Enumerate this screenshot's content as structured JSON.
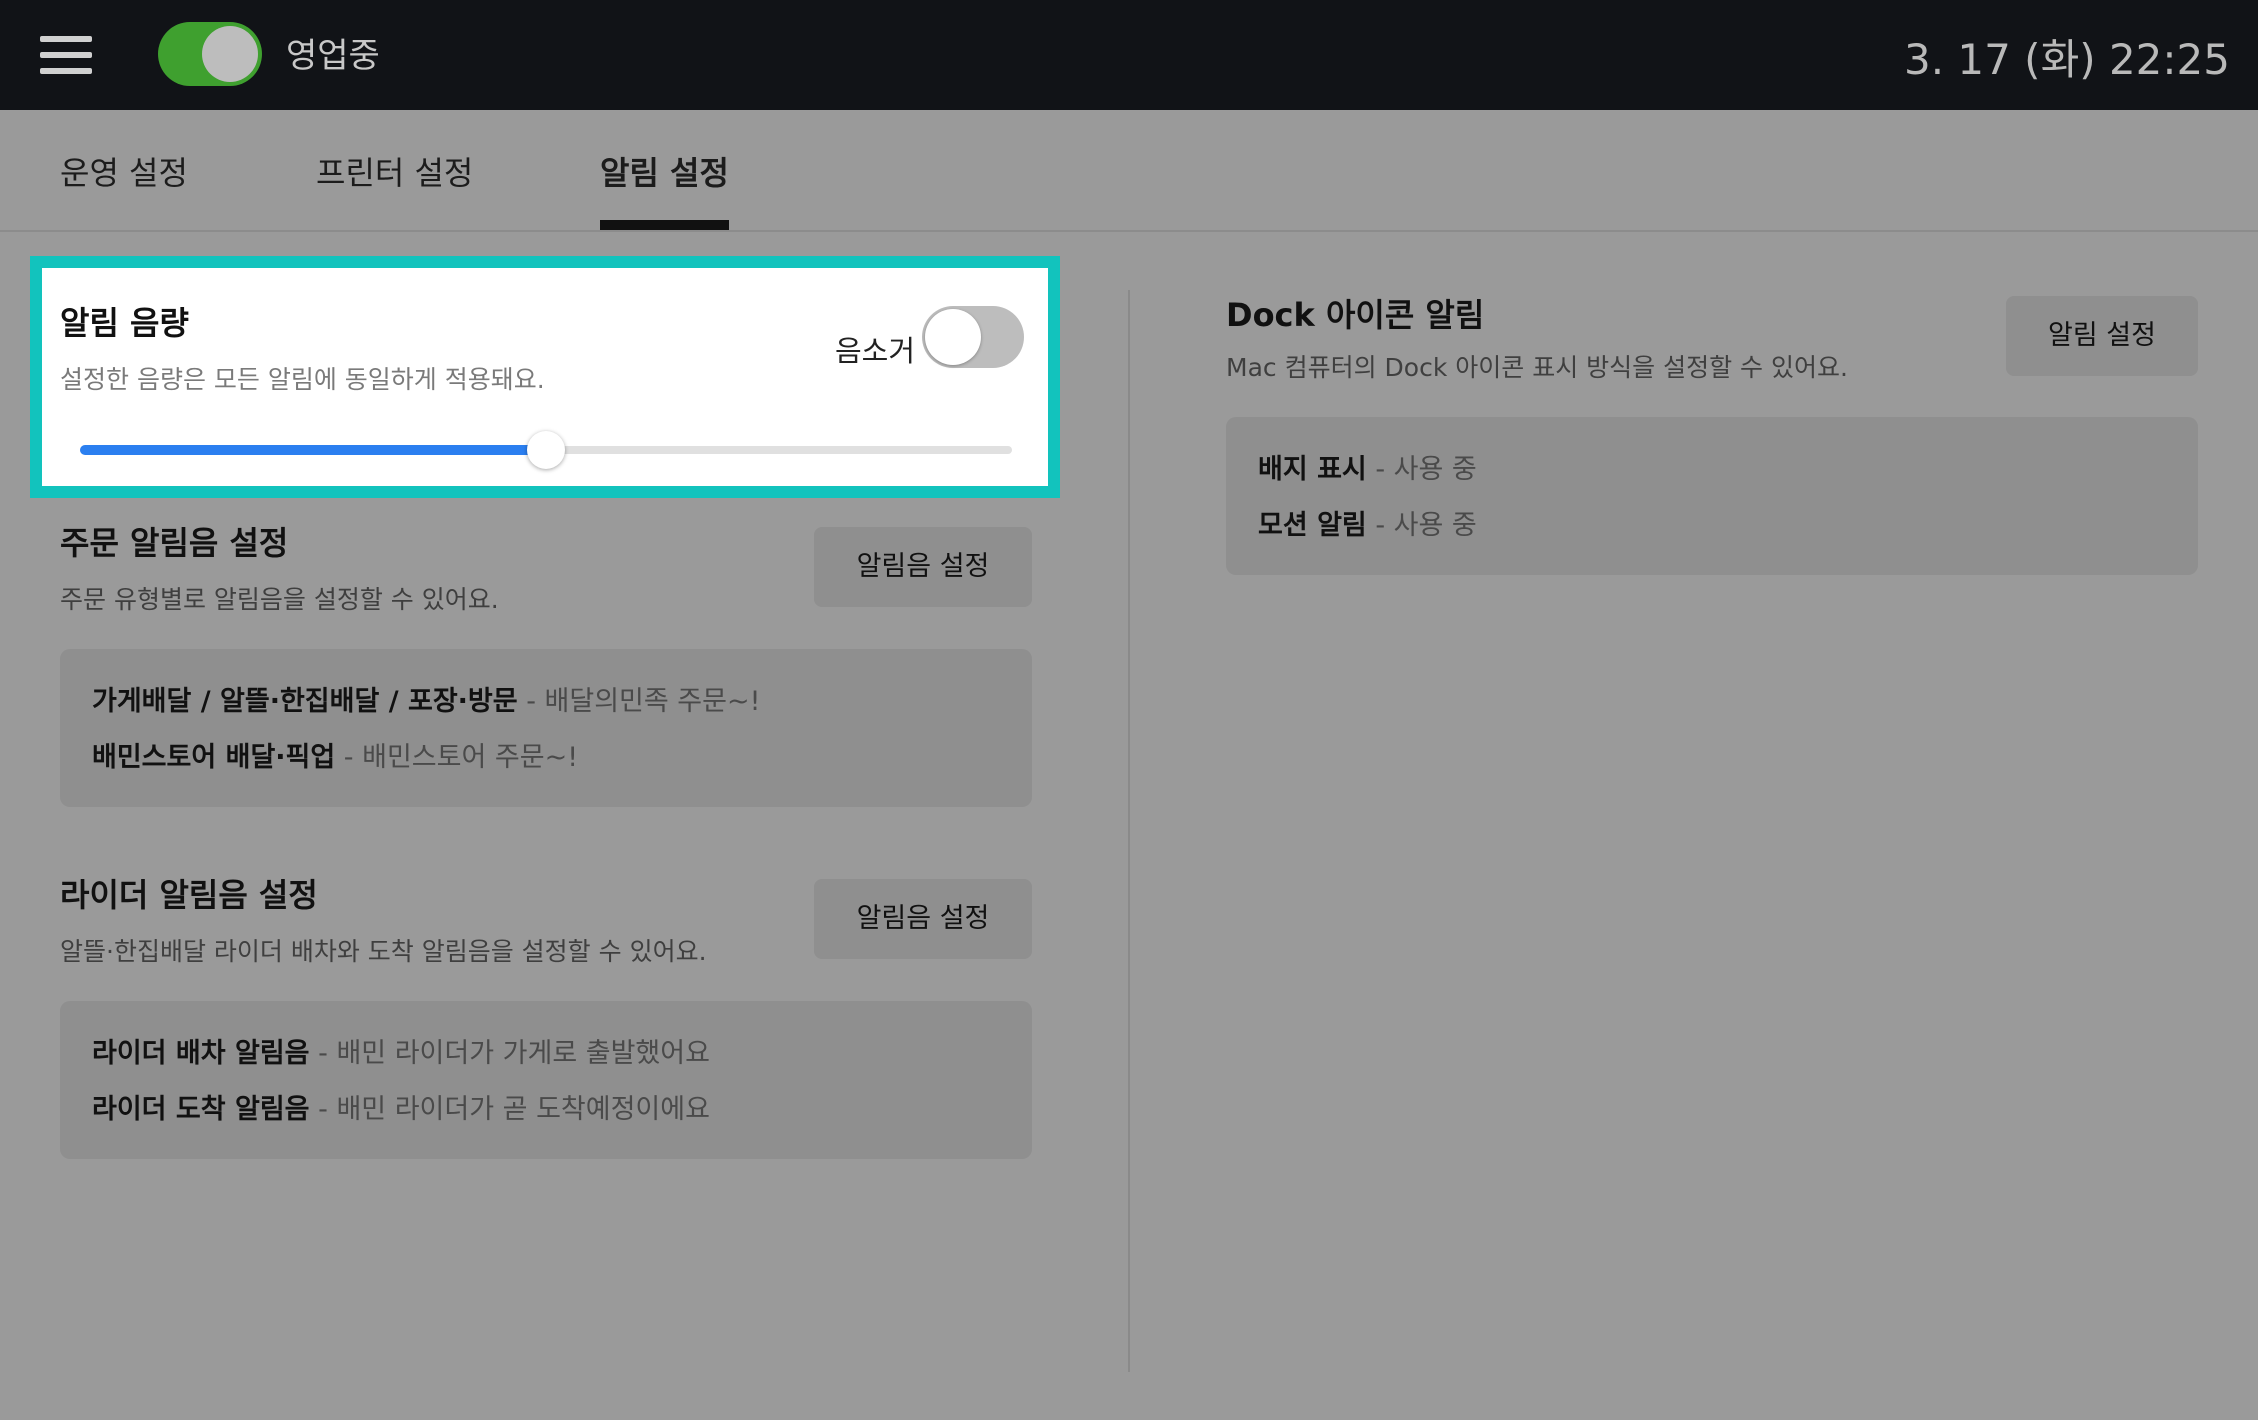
{
  "topbar": {
    "operating_label": "영업중",
    "operating_on": true,
    "datetime": "3. 17 (화) 22:25"
  },
  "tabs": [
    {
      "label": "운영 설정",
      "active": false
    },
    {
      "label": "프린터 설정",
      "active": false
    },
    {
      "label": "알림 설정",
      "active": true
    }
  ],
  "volume": {
    "title": "알림 음량",
    "subtitle": "설정한 음량은 모든 알림에 동일하게 적용돼요.",
    "mute_label": "음소거",
    "mute_on": false,
    "level_percent": 50
  },
  "order_sound": {
    "title": "주문 알림음 설정",
    "subtitle": "주문 유형별로 알림음을 설정할 수 있어요.",
    "button": "알림음 설정",
    "items": [
      {
        "name": "가게배달 / 알뜰·한집배달 / 포장·방문",
        "value": " - 배달의민족 주문~!"
      },
      {
        "name": "배민스토어 배달·픽업",
        "value": " - 배민스토어 주문~!"
      }
    ]
  },
  "rider_sound": {
    "title": "라이더 알림음 설정",
    "subtitle": "알뜰·한집배달 라이더 배차와 도착 알림음을 설정할 수 있어요.",
    "button": "알림음 설정",
    "items": [
      {
        "name": "라이더 배차 알림음",
        "value": " - 배민 라이더가 가게로 출발했어요"
      },
      {
        "name": "라이더 도착 알림음",
        "value": " - 배민 라이더가 곧 도착예정이에요"
      }
    ]
  },
  "dock": {
    "title": "Dock 아이콘 알림",
    "subtitle": "Mac 컴퓨터의 Dock 아이콘 표시 방식을 설정할 수 있어요.",
    "button": "알림 설정",
    "items": [
      {
        "name": "배지 표시",
        "value": " - 사용 중"
      },
      {
        "name": "모션 알림",
        "value": " - 사용 중"
      }
    ]
  },
  "colors": {
    "highlight": "#12c3bd",
    "toggle_on": "#3fa02f",
    "slider_fill": "#2b7ff0"
  }
}
